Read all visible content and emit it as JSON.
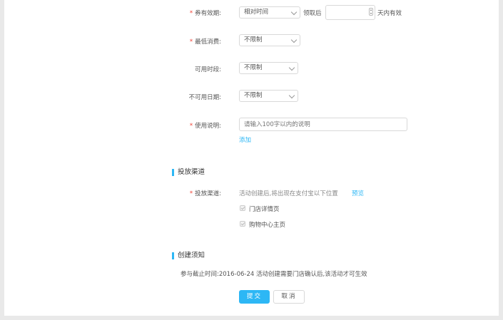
{
  "form": {
    "validity": {
      "label": "券有效期:",
      "select_value": "相对时间",
      "prefix": "领取后",
      "days_value": "",
      "suffix": "天内有效"
    },
    "min_spend": {
      "label": "最低消费:",
      "select_value": "不限制"
    },
    "available_time": {
      "label": "可用时段:",
      "select_value": "不限制"
    },
    "unavailable_date": {
      "label": "不可用日期:",
      "select_value": "不限制"
    },
    "usage_note": {
      "label": "使用说明:",
      "placeholder": "请输入100字以内的说明",
      "add_link": "添加"
    }
  },
  "channel": {
    "section_title": "投放渠道",
    "label": "投放渠道:",
    "description": "活动创建后,将出现在支付宝以下位置",
    "preview_link": "预览",
    "options": [
      {
        "label": "门店详情页",
        "checked": true
      },
      {
        "label": "购物中心主页",
        "checked": true
      }
    ]
  },
  "notice": {
    "section_title": "创建须知",
    "text": "参与截止时间:2016-06-24 活动创建需要门店确认后,该活动才可生效"
  },
  "actions": {
    "submit_label": "提交",
    "cancel_label": "取消"
  },
  "colors": {
    "accent": "#2db7f5",
    "required": "#f04134",
    "page_bg": "#e9e9e9"
  }
}
